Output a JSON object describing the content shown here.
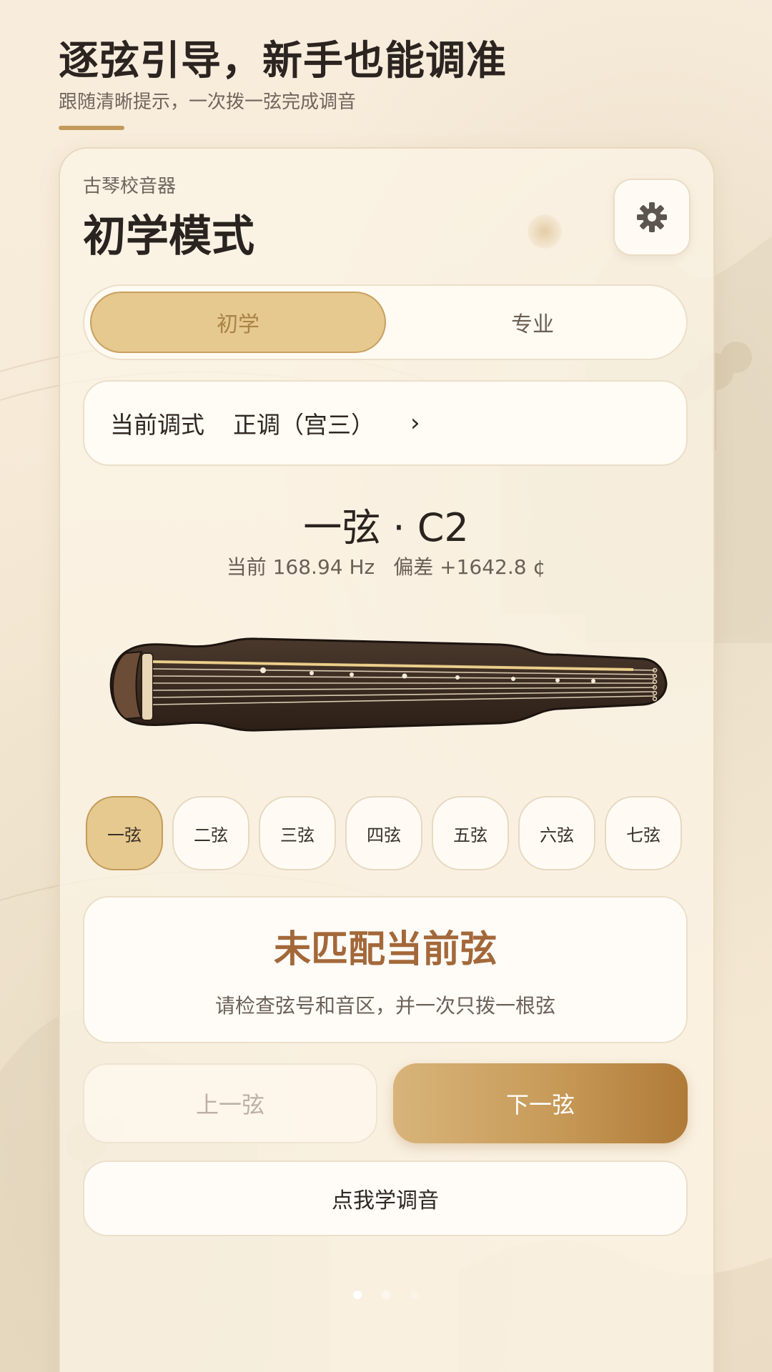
{
  "header": {
    "headline": "逐弦引导，新手也能调准",
    "subheadline": "跟随清晰提示，一次拨一弦完成调音"
  },
  "app": {
    "name": "古琴校音器",
    "mode_title": "初学模式",
    "settings_icon": "gear-icon"
  },
  "mode_switch": {
    "options": [
      {
        "label": "初学",
        "selected": true
      },
      {
        "label": "专业",
        "selected": false
      }
    ]
  },
  "tuning": {
    "label": "当前调式",
    "value": "正调（宫三）",
    "chevron": "›"
  },
  "current_string": {
    "title": "一弦 · C2",
    "frequency_text": "当前 168.94 Hz",
    "deviation_text": "偏差 +1642.8 ¢"
  },
  "string_buttons": [
    {
      "label": "一弦",
      "active": true
    },
    {
      "label": "二弦",
      "active": false
    },
    {
      "label": "三弦",
      "active": false
    },
    {
      "label": "四弦",
      "active": false
    },
    {
      "label": "五弦",
      "active": false
    },
    {
      "label": "六弦",
      "active": false
    },
    {
      "label": "七弦",
      "active": false
    }
  ],
  "status": {
    "title": "未匹配当前弦",
    "hint": "请检查弦号和音区，并一次只拨一根弦"
  },
  "nav": {
    "prev_label": "上一弦",
    "prev_enabled": false,
    "next_label": "下一弦",
    "learn_label": "点我学调音"
  },
  "pager": {
    "count": 3,
    "active_index": 0
  },
  "colors": {
    "accent_gold": "#e6c98e",
    "status_brown": "#a3683a",
    "qin_body": "#3a2a20"
  }
}
